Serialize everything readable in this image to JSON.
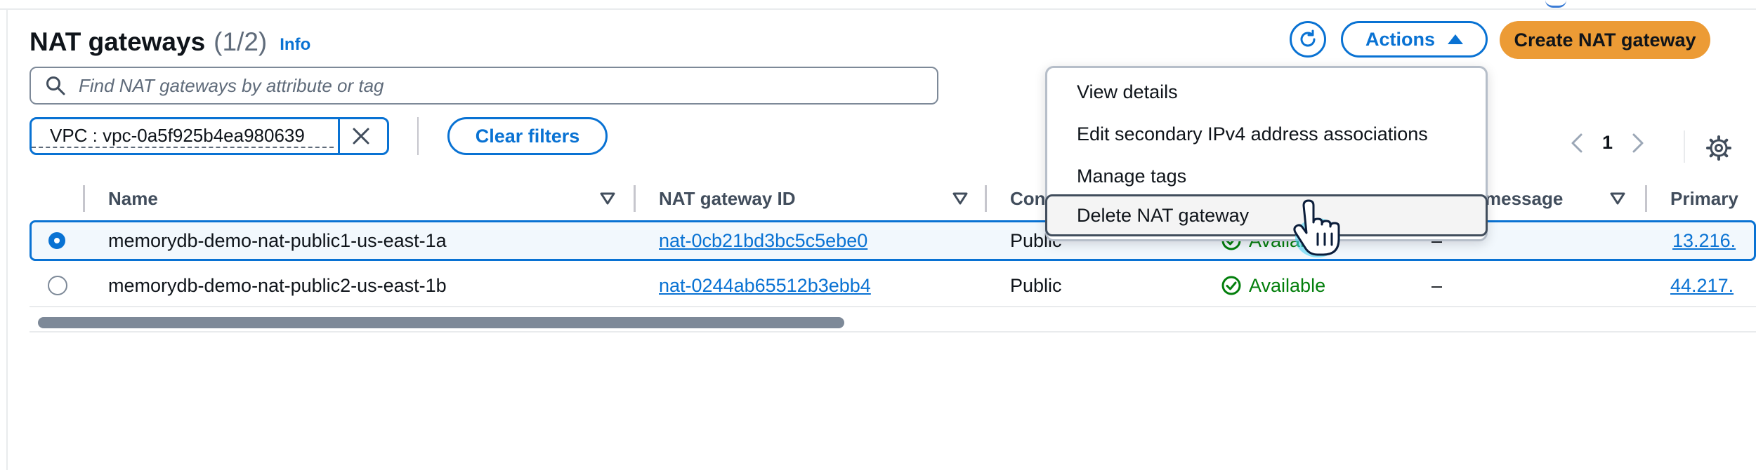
{
  "header": {
    "title": "NAT gateways",
    "count": "(1/2)",
    "info": "Info"
  },
  "toolbar": {
    "refresh_icon": "refresh-icon",
    "actions_label": "Actions",
    "create_label": "Create NAT gateway"
  },
  "search": {
    "placeholder": "Find NAT gateways by attribute or tag"
  },
  "filter": {
    "token": "VPC : vpc-0a5f925b4ea980639",
    "clear_label": "Clear filters"
  },
  "pagination": {
    "current_page": "1"
  },
  "table": {
    "columns": [
      "Name",
      "NAT gateway ID",
      "Con",
      "message",
      "Primary"
    ],
    "rows": [
      {
        "selected": true,
        "name": "memorydb-demo-nat-public1-us-east-1a",
        "id": "nat-0cb21bd3bc5c5ebe0",
        "connectivity": "Public",
        "state": "Available",
        "message": "–",
        "primary_ip": "13.216."
      },
      {
        "selected": false,
        "name": "memorydb-demo-nat-public2-us-east-1b",
        "id": "nat-0244ab65512b3ebb4",
        "connectivity": "Public",
        "state": "Available",
        "message": "–",
        "primary_ip": "44.217."
      }
    ]
  },
  "actions_menu": {
    "items": [
      "View details",
      "Edit secondary IPv4 address associations",
      "Manage tags",
      "Delete NAT gateway"
    ],
    "highlighted": "Delete NAT gateway"
  },
  "colors": {
    "accent": "#0972d3",
    "primary_button": "#ec9b35",
    "success": "#037f0c"
  }
}
